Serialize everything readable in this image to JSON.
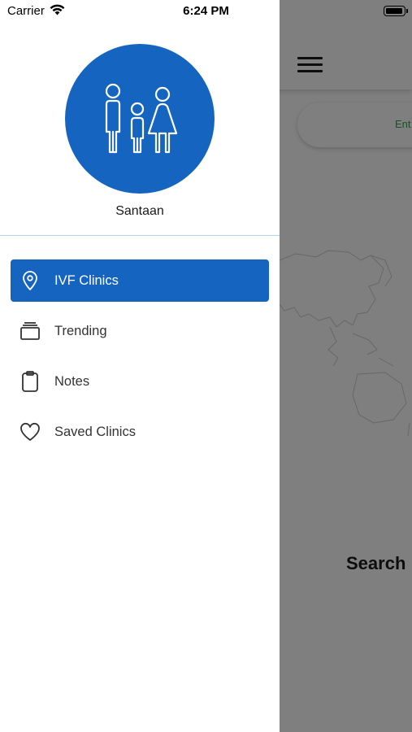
{
  "status_bar": {
    "carrier": "Carrier",
    "time": "6:24 PM"
  },
  "drawer": {
    "app_name": "Santaan",
    "menu_items": [
      {
        "label": "IVF Clinics",
        "icon": "location-pin-icon",
        "active": true
      },
      {
        "label": "Trending",
        "icon": "stack-icon",
        "active": false
      },
      {
        "label": "Notes",
        "icon": "clipboard-icon",
        "active": false
      },
      {
        "label": "Saved Clinics",
        "icon": "heart-icon",
        "active": false
      }
    ]
  },
  "main": {
    "search_hint": "Ent",
    "heading": "Search"
  },
  "colors": {
    "accent": "#1565c0",
    "hint_green": "#2ea44f"
  }
}
